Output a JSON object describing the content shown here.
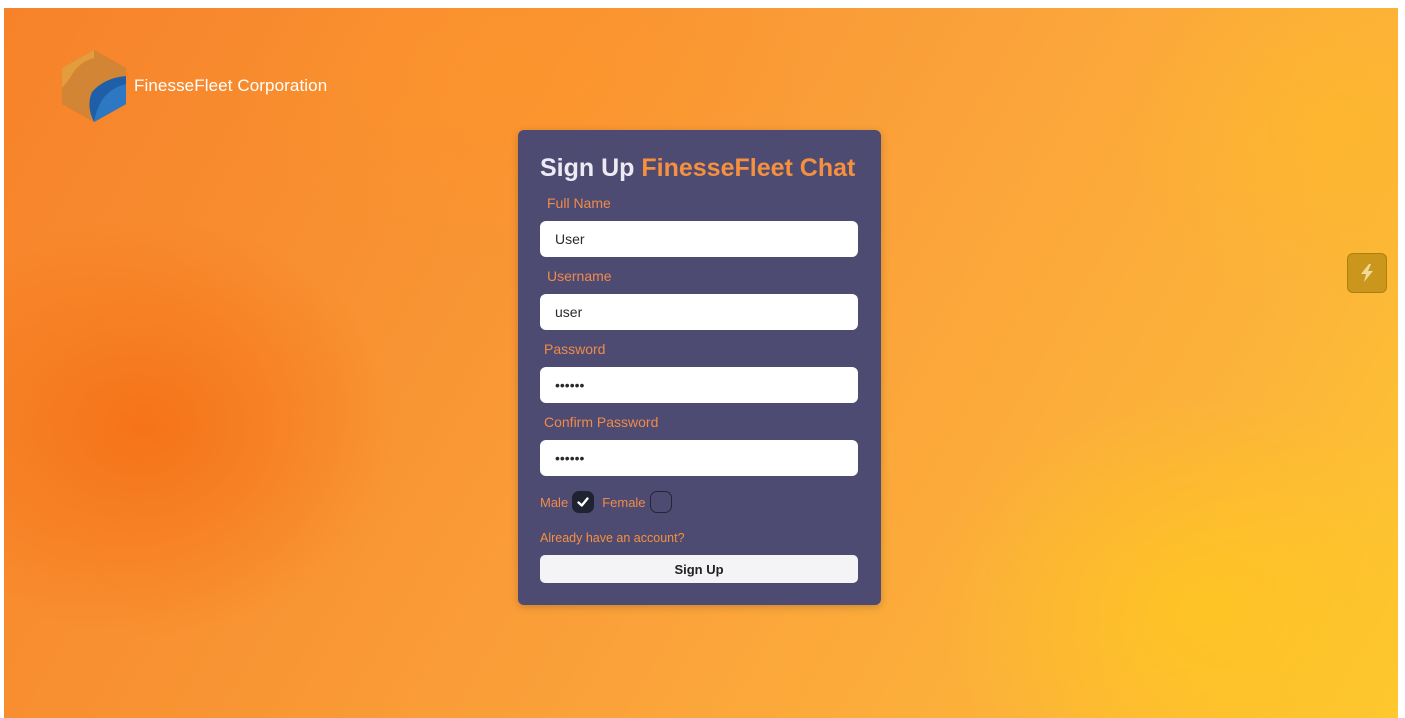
{
  "company": {
    "name": "FinesseFleet Corporation"
  },
  "form": {
    "title_lead": "Sign Up",
    "title_brand": "FinesseFleet Chat",
    "fields": [
      {
        "label": "Full Name",
        "value": "User"
      },
      {
        "label": "Username",
        "value": "user"
      },
      {
        "label": "Password",
        "value": "••••••"
      },
      {
        "label": "Confirm Password",
        "value": "••••••"
      }
    ],
    "gender": {
      "male_label": "Male",
      "male_checked": true,
      "female_label": "Female",
      "female_checked": false
    },
    "login_link": "Already have an account?",
    "submit_label": "Sign Up"
  },
  "side_widget": {
    "icon": "lightning-bolt-icon"
  },
  "colors": {
    "card_background": "#4e4b72",
    "accent_orange": "#f5903e",
    "label_orange": "#f08a4a",
    "checkbox_dark": "#1f2230",
    "background_orange": "#f7822a",
    "background_yellow": "#fec830"
  }
}
